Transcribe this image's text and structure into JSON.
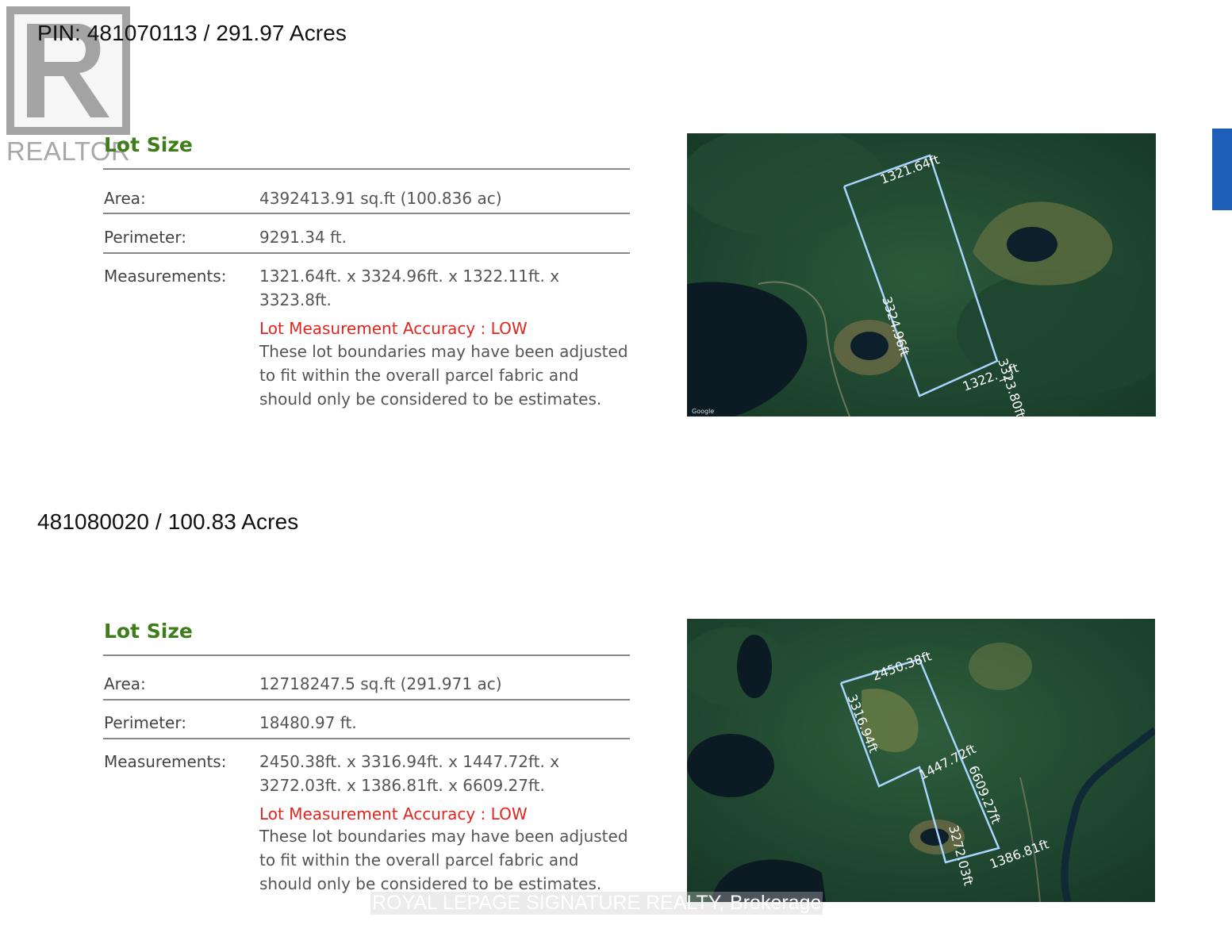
{
  "parcels": [
    {
      "heading": "PIN: 481070113 / 291.97 Acres",
      "section_title": "Lot Size",
      "area_label": "Area:",
      "area_value": "4392413.91 sq.ft (100.836 ac)",
      "perimeter_label": "Perimeter:",
      "perimeter_value": "9291.34 ft.",
      "measurements_label": "Measurements:",
      "measurements_value": "1321.64ft. x 3324.96ft. x 1322.11ft. x 3323.8ft.",
      "accuracy": "Lot Measurement Accuracy : LOW",
      "note": "These lot boundaries may have been adjusted to fit within the overall parcel fabric and should only be considered to be estimates.",
      "map_labels": [
        "1321.64ft",
        "3324.96ft",
        "1322.__ft",
        "3323.80ft"
      ],
      "map_credit": "Google"
    },
    {
      "heading": "481080020 / 100.83 Acres",
      "section_title": "Lot Size",
      "area_label": "Area:",
      "area_value": "12718247.5 sq.ft (291.971 ac)",
      "perimeter_label": "Perimeter:",
      "perimeter_value": "18480.97 ft.",
      "measurements_label": "Measurements:",
      "measurements_value": "2450.38ft. x 3316.94ft. x 1447.72ft. x 3272.03ft. x 1386.81ft. x 6609.27ft.",
      "accuracy": "Lot Measurement Accuracy : LOW",
      "note": "These lot boundaries may have been adjusted to fit within the overall parcel fabric and should only be considered to be estimates.",
      "map_labels": [
        "2450.38ft",
        "3316.94ft",
        "1447.72ft",
        "6609.27ft",
        "3272.03ft",
        "1386.81ft"
      ]
    }
  ],
  "brand": {
    "realtor": "REALTOR",
    "watermark": "ROYAL LEPAGE SIGNATURE REALTY, Brokerage"
  },
  "colors": {
    "section_title": "#3e7d1a",
    "accuracy": "#e0261e",
    "boundary": "#a9d4ff"
  }
}
